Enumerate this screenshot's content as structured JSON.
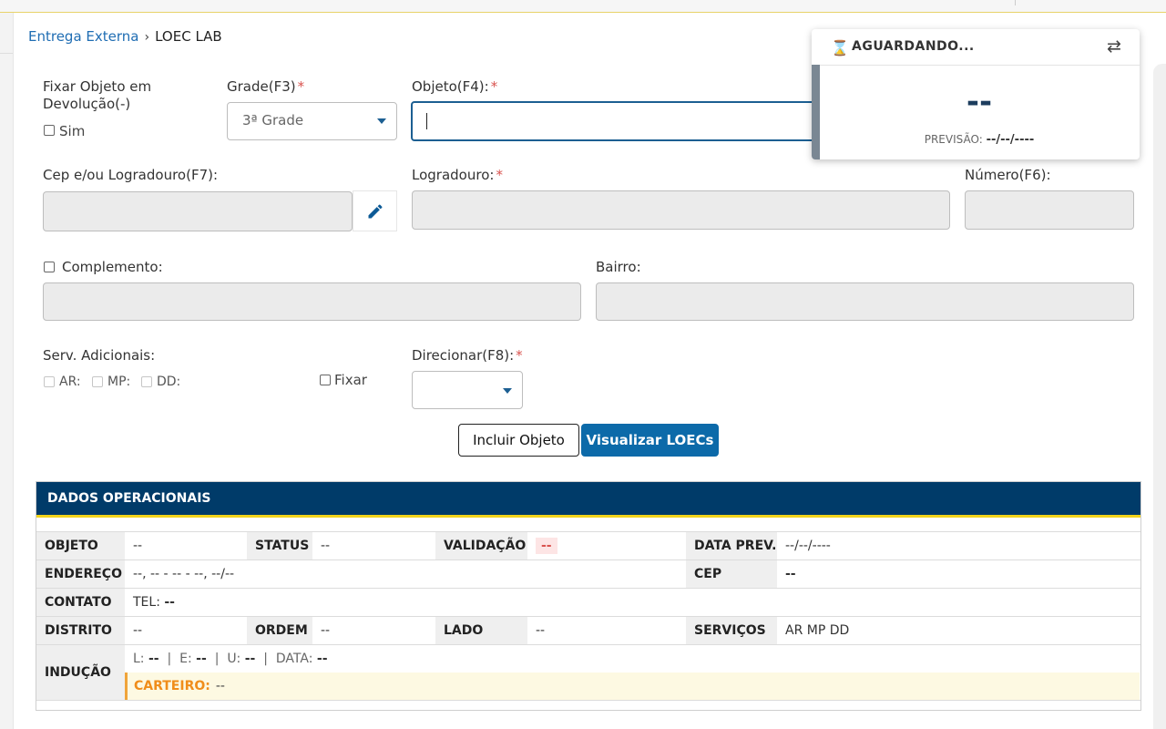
{
  "breadcrumb": {
    "parent": "Entrega Externa",
    "current": "LOEC LAB"
  },
  "form": {
    "fixar_objeto_label": "Fixar Objeto em Devolução(-)",
    "fixar_objeto_option": "Sim",
    "grade_label": "Grade(F3)",
    "grade_value": "3ª Grade",
    "objeto_label": "Objeto(F4):",
    "cep_label": "Cep e/ou Logradouro(F7):",
    "logradouro_label": "Logradouro:",
    "numero_label": "Número(F6):",
    "complemento_label": "Complemento:",
    "bairro_label": "Bairro:",
    "serv_label": "Serv. Adicionais:",
    "serv_ar": "AR:",
    "serv_mp": "MP:",
    "serv_dd": "DD:",
    "fixar_label": "Fixar",
    "direcionar_label": "Direcionar(F8):",
    "required_mark": "*"
  },
  "buttons": {
    "incluir": "Incluir Objeto",
    "visualizar": "Visualizar LOECs"
  },
  "panel": {
    "title": "DADOS OPERACIONAIS",
    "objeto_k": "OBJETO",
    "objeto_v": "--",
    "status_k": "STATUS",
    "status_v": "--",
    "validacao_k": "VALIDAÇÃO",
    "validacao_v": "--",
    "dataprev_k": "DATA PREV.",
    "dataprev_v": "--/--/----",
    "endereco_k": "ENDEREÇO",
    "endereco_v": "--, -- - -- - --, --/--",
    "cep_k": "CEP",
    "cep_v": "--",
    "contato_k": "CONTATO",
    "contato_tel": "TEL:",
    "contato_v": "--",
    "distrito_k": "DISTRITO",
    "distrito_v": "--",
    "ordem_k": "ORDEM",
    "ordem_v": "--",
    "lado_k": "LADO",
    "lado_v": "--",
    "servicos_k": "SERVIÇOS",
    "servicos_v": "AR MP DD",
    "inducao_k": "INDUÇÃO",
    "ind_l_k": "L:",
    "ind_l_v": "--",
    "ind_e_k": "E:",
    "ind_e_v": "--",
    "ind_u_k": "U:",
    "ind_u_v": "--",
    "ind_data_k": "DATA:",
    "ind_data_v": "--",
    "ind_sep": "|",
    "carteiro_k": "CARTEIRO:",
    "carteiro_v": "--"
  },
  "status_popup": {
    "title": "AGUARDANDO...",
    "value": "--",
    "previsao_label": "PREVISÃO:",
    "previsao_value": "--/--/----"
  },
  "colors": {
    "primary": "#0c6aa9",
    "header": "#003b69",
    "accent": "#f2d31b",
    "required": "#d9534f",
    "link": "#1f6db3"
  },
  "icons": {
    "edit": "pencil-icon",
    "hourglass": "hourglass-icon",
    "swap": "swap-icon",
    "dropdown": "caret-down-icon"
  }
}
